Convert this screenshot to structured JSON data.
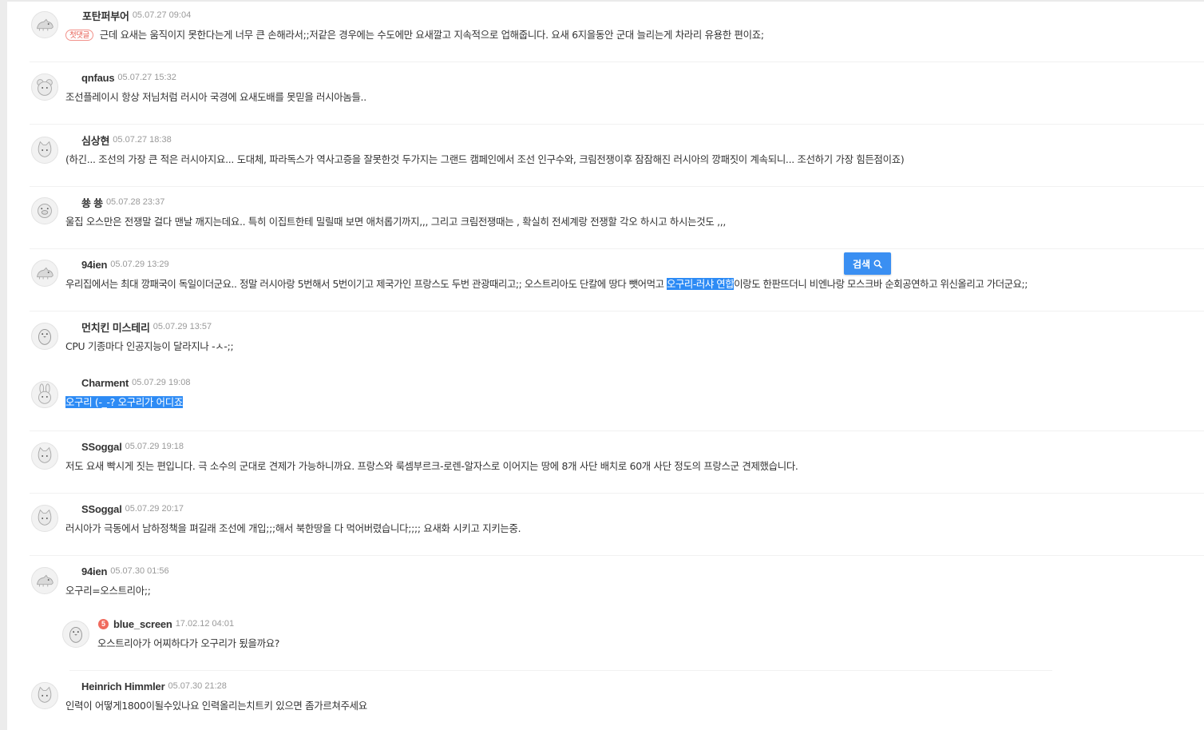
{
  "search_popup": {
    "label": "검색",
    "icon": "search-icon"
  },
  "comments": [
    {
      "author": "포탄퍼부어",
      "date": "05.07.27 09:04",
      "badge": "첫댓글",
      "text": "근데 요새는 움직이지 못한다는게 너무 큰 손해라서;;저같은 경우에는 수도에만 요새깔고 지속적으로 업해줍니다. 요새 6지을동안 군대 늘리는게 차라리 유용한 편이죠;",
      "avatar": "dinosaur-avatar-icon"
    },
    {
      "author": "qnfaus",
      "date": "05.07.27 15:32",
      "text": "조선플레이시 항상 저님처럼 러시아 국경에 요새도배를 못믿을 러시아놈들..",
      "avatar": "bear-avatar-icon"
    },
    {
      "author": "심상현",
      "date": "05.07.27 18:38",
      "text": "(하긴... 조선의 가장 큰 적은 러시아지요... 도대체, 파라독스가 역사고증을 잘못한것 두가지는 그랜드 캠페인에서 조선 인구수와, 크림전쟁이후 잠잠해진 러시아의 깡패짓이 계속되니... 조선하기 가장 힘든점이죠)",
      "avatar": "cat-avatar-icon"
    },
    {
      "author": "쑝 쑝",
      "date": "05.07.28 23:37",
      "text": "울집 오스만은 전쟁말 걸다 맨날 깨지는데요.. 특히 이집트한테 밀릴때 보면 애처롭기까지,,, 그리고 크림전쟁때는 , 확실히 전세계랑 전쟁할 각오 하시고 하시는것도 ,,,",
      "avatar": "pig-avatar-icon"
    },
    {
      "author": "94ien",
      "date": "05.07.29 13:29",
      "text_before": "우리집에서는 최대 깡패국이 독일이더군요.. 정말 러시아랑 5번해서 5번이기고 제국가인 프랑스도 두번 관광때리고;; 오스트리아도 단칼에 땅다 뺏어먹고 ",
      "text_highlight": "오구리-러샤 연합",
      "text_after": "이랑도 한판뜨더니 비엔나랑 모스크바 순회공연하고 위신올리고 가더군요;;",
      "avatar": "dinosaur-avatar-icon"
    },
    {
      "author": "먼치킨 미스테리",
      "date": "05.07.29 13:57",
      "text": "CPU 기종마다 인공지능이 달라지나 -ㅅ-;;",
      "avatar": "penguin-avatar-icon"
    },
    {
      "author": "Charment",
      "date": "05.07.29 19:08",
      "text_highlight": "오구리 (-_-? 오구리가 어디죠",
      "avatar": "rabbit-avatar-icon"
    },
    {
      "author": "SSoggal",
      "date": "05.07.29 19:18",
      "text": "저도 요새 빡시게 짓는 편입니다. 극 소수의 군대로 견제가 가능하니까요. 프랑스와 룩셈부르크-로렌-알자스로 이어지는 땅에 8개 사단 배치로 60개 사단 정도의 프랑스군 견제했습니다.",
      "avatar": "cat-avatar-icon"
    },
    {
      "author": "SSoggal",
      "date": "05.07.29 20:17",
      "text": "러시아가 극동에서 남하정책을 펴길래 조선에 개입;;;해서 북한땅을 다 먹어버렸습니다;;;; 요새화 시키고 지키는중.",
      "avatar": "cat-avatar-icon"
    },
    {
      "author": "94ien",
      "date": "05.07.30 01:56",
      "text": "오구리=오스트리아;;",
      "avatar": "dinosaur-avatar-icon"
    },
    {
      "author": "blue_screen",
      "date": "17.02.12 04:01",
      "level": "5",
      "reply": true,
      "text": "오스트리아가 어찌하다가 오구리가 됬을까요?",
      "avatar": "penguin-avatar-icon"
    },
    {
      "author": "Heinrich Himmler",
      "date": "05.07.30 21:28",
      "text": "인력이 어떻게1800이될수있나요 인력올리는치트키 있으면 좀가르쳐주세요",
      "avatar": "cat-avatar-icon"
    }
  ]
}
